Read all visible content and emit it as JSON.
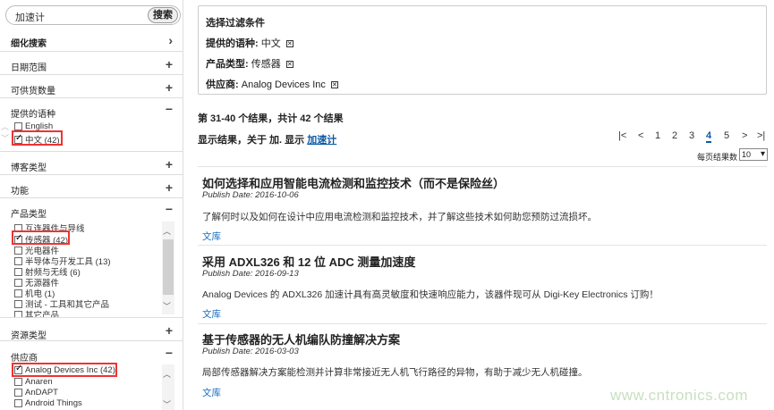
{
  "search": {
    "value": "加速计",
    "button": "搜索"
  },
  "sidebar": {
    "refine": "细化搜索",
    "date_range": "日期范围",
    "stock_qty": "可供货数量",
    "language": {
      "title": "提供的语种",
      "options": [
        {
          "label": "English",
          "checked": false
        },
        {
          "label": "中文 (42)",
          "checked": true
        }
      ]
    },
    "blog_type": "博客类型",
    "function": "功能",
    "product_type": {
      "title": "产品类型",
      "options": [
        {
          "label": "互连器件与导线",
          "checked": false
        },
        {
          "label": "传感器 (42)",
          "checked": true
        },
        {
          "label": "光电器件",
          "checked": false
        },
        {
          "label": "半导体与开发工具 (13)",
          "checked": false
        },
        {
          "label": "射频与无线 (6)",
          "checked": false
        },
        {
          "label": "无源器件",
          "checked": false
        },
        {
          "label": "机电 (1)",
          "checked": false
        },
        {
          "label": "测试 - 工具和其它产品",
          "checked": false
        },
        {
          "label": "其它产品",
          "checked": false
        }
      ]
    },
    "resource_type": "资源类型",
    "supplier": {
      "title": "供应商",
      "options": [
        {
          "label": "Analog Devices Inc (42)",
          "checked": true
        },
        {
          "label": "Anaren",
          "checked": false
        },
        {
          "label": "AnDAPT",
          "checked": false
        },
        {
          "label": "Android Things",
          "checked": false
        }
      ]
    }
  },
  "filters": {
    "title": "选择过滤条件",
    "rows": [
      {
        "label": "提供的语种:",
        "value": "中文"
      },
      {
        "label": "产品类型:",
        "value": "传感器"
      },
      {
        "label": "供应商:",
        "value": "Analog Devices Inc"
      }
    ],
    "remove_icon": "close-icon"
  },
  "results": {
    "count_text": "第 31-40 个结果，共计 42 个结果",
    "show_prefix": "显示结果，关于 加. 显示",
    "show_link": "加速计",
    "pager": {
      "first": "|<",
      "prev": "<",
      "pages": [
        "1",
        "2",
        "3",
        "4",
        "5"
      ],
      "current": "4",
      "next": ">",
      "last": ">|"
    },
    "per_page_label": "每页结果数",
    "per_page_value": "10",
    "items": [
      {
        "title": "如何选择和应用智能电流检测和监控技术（而不是保险丝）",
        "date": "Publish Date: 2016-10-06",
        "desc": "了解何时以及如何在设计中应用电流检测和监控技术，并了解这些技术如何助您预防过流损坏。",
        "tag": "文库"
      },
      {
        "title": "采用 ADXL326 和 12 位 ADC 测量加速度",
        "date": "Publish Date: 2016-09-13",
        "desc": "Analog Devices 的 ADXL326 加速计具有高灵敏度和快速响应能力，该器件现可从 Digi-Key Electronics 订购！",
        "tag": "文库"
      },
      {
        "title": "基于传感器的无人机编队防撞解决方案",
        "date": "Publish Date: 2016-03-03",
        "desc": "局部传感器解决方案能检测并计算非常接近无人机飞行路径的异物，有助于减少无人机碰撞。",
        "tag": "文库"
      }
    ]
  },
  "watermark": "www.cntronics.com",
  "colors": {
    "link": "#0b5aa6",
    "highlight": "#e33333"
  }
}
